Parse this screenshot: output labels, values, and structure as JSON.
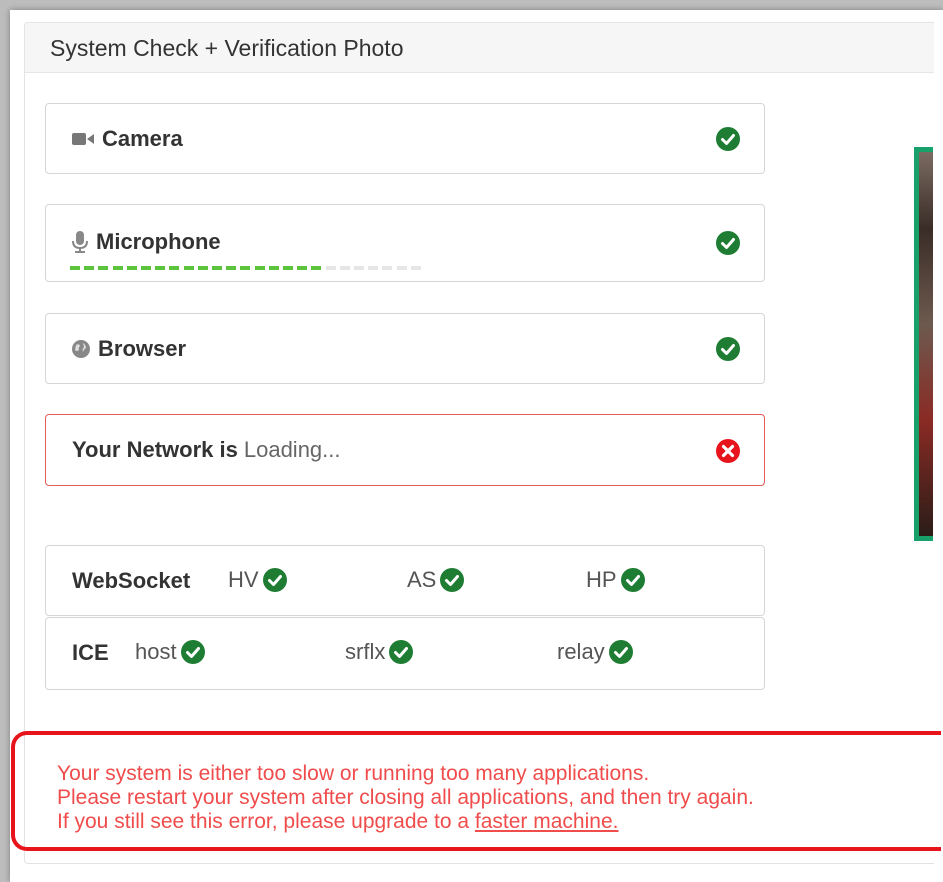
{
  "panel": {
    "title": "System Check + Verification Photo"
  },
  "checks": [
    {
      "label": "Camera",
      "icon": "video-camera-icon",
      "status": "ok"
    },
    {
      "label": "Microphone",
      "icon": "microphone-icon",
      "status": "ok",
      "level_fraction": 0.71
    },
    {
      "label": "Browser",
      "icon": "globe-icon",
      "status": "ok"
    }
  ],
  "network": {
    "label": "Your Network is",
    "value": "Loading...",
    "status": "error"
  },
  "websocket": {
    "label": "WebSocket",
    "items": [
      {
        "label": "HV",
        "status": "ok"
      },
      {
        "label": "AS",
        "status": "ok"
      },
      {
        "label": "HP",
        "status": "ok"
      }
    ]
  },
  "ice": {
    "label": "ICE",
    "items": [
      {
        "label": "host",
        "status": "ok"
      },
      {
        "label": "srflx",
        "status": "ok"
      },
      {
        "label": "relay",
        "status": "ok"
      }
    ]
  },
  "alert": {
    "line1": "Your system is either too slow or running too many applications.",
    "line2": "Please restart your system after closing all applications, and then try again.",
    "line3_prefix": "If you still see this error, please upgrade to a ",
    "line3_link": "faster machine."
  },
  "colors": {
    "ok": "#1e7d32",
    "error": "#e8141b",
    "level_on": "#5cc43c",
    "level_off": "#e6e6e6",
    "alert_text": "#f04c4c",
    "preview_border": "#18a06a"
  }
}
